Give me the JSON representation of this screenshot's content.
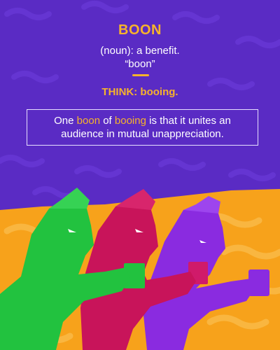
{
  "word": "BOON",
  "definition_line1": "(noun): a benefit.",
  "definition_line2": "“boon”",
  "think": "THINK: booing.",
  "sentence": {
    "part1": "One ",
    "highlight1": "boon",
    "part2": " of ",
    "highlight2": "booing",
    "part3": " is that it unites an audience in mutual unappreciation."
  },
  "colors": {
    "background_top": "#5a2bc4",
    "background_bottom": "#f7a21b",
    "accent": "#f7b32b",
    "figure_green": "#22c23f",
    "figure_red": "#c8145a",
    "figure_purple": "#8a2be0"
  }
}
